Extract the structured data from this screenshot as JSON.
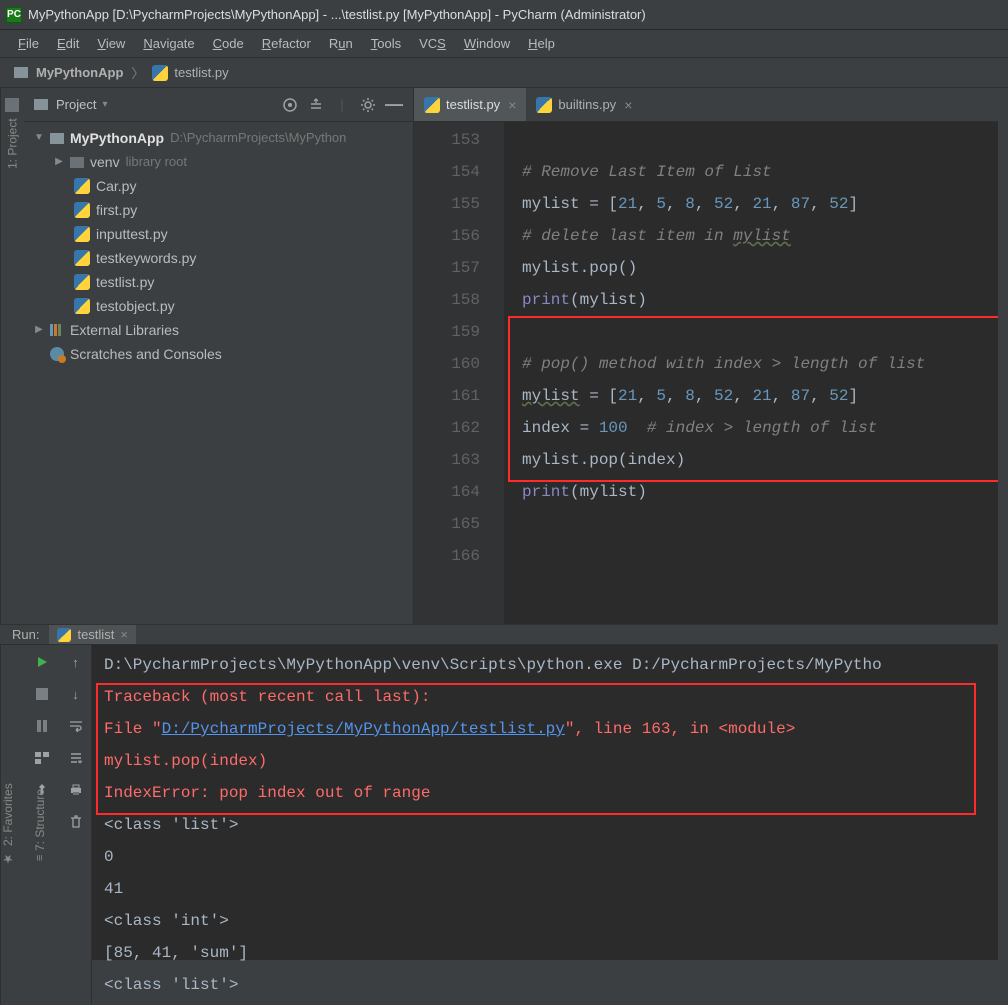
{
  "titlebar": {
    "app_icon": "PC",
    "title": "MyPythonApp [D:\\PycharmProjects\\MyPythonApp] - ...\\testlist.py [MyPythonApp] - PyCharm (Administrator)"
  },
  "menubar": [
    "File",
    "Edit",
    "View",
    "Navigate",
    "Code",
    "Refactor",
    "Run",
    "Tools",
    "VCS",
    "Window",
    "Help"
  ],
  "breadcrumb": {
    "project": "MyPythonApp",
    "file": "testlist.py"
  },
  "leftbar": {
    "project_label": "1: Project"
  },
  "project_panel": {
    "title": "Project",
    "tree": {
      "root": {
        "name": "MyPythonApp",
        "path": "D:\\PycharmProjects\\MyPython"
      },
      "venv": {
        "name": "venv",
        "hint": "library root"
      },
      "files": [
        "Car.py",
        "first.py",
        "inputtest.py",
        "testkeywords.py",
        "testlist.py",
        "testobject.py"
      ],
      "external_libs": "External Libraries",
      "scratches": "Scratches and Consoles"
    }
  },
  "editor": {
    "tabs": [
      {
        "label": "testlist.py",
        "active": true
      },
      {
        "label": "builtins.py",
        "active": false
      }
    ],
    "lines": [
      {
        "no": 153,
        "tokens": []
      },
      {
        "no": 154,
        "tokens": [
          [
            "comment",
            "# Remove Last Item of List"
          ]
        ]
      },
      {
        "no": 155,
        "tokens": [
          [
            "id",
            "mylist"
          ],
          [
            "op",
            " = ["
          ],
          [
            "num",
            "21"
          ],
          [
            "op",
            ", "
          ],
          [
            "num",
            "5"
          ],
          [
            "op",
            ", "
          ],
          [
            "num",
            "8"
          ],
          [
            "op",
            ", "
          ],
          [
            "num",
            "52"
          ],
          [
            "op",
            ", "
          ],
          [
            "num",
            "21"
          ],
          [
            "op",
            ", "
          ],
          [
            "num",
            "87"
          ],
          [
            "op",
            ", "
          ],
          [
            "num",
            "52"
          ],
          [
            "op",
            "]"
          ]
        ]
      },
      {
        "no": 156,
        "tokens": [
          [
            "comment",
            "# delete last item in "
          ],
          [
            "comment-ul",
            "mylist"
          ]
        ]
      },
      {
        "no": 157,
        "tokens": [
          [
            "id",
            "mylist"
          ],
          [
            "op",
            ".pop()"
          ]
        ]
      },
      {
        "no": 158,
        "tokens": [
          [
            "builtin",
            "print"
          ],
          [
            "op",
            "(mylist)"
          ]
        ]
      },
      {
        "no": 159,
        "tokens": []
      },
      {
        "no": 160,
        "tokens": [
          [
            "comment",
            "# pop() method with index > length of list"
          ]
        ]
      },
      {
        "no": 161,
        "tokens": [
          [
            "id-ul",
            "mylist"
          ],
          [
            "op",
            " = ["
          ],
          [
            "num",
            "21"
          ],
          [
            "op",
            ", "
          ],
          [
            "num",
            "5"
          ],
          [
            "op",
            ", "
          ],
          [
            "num",
            "8"
          ],
          [
            "op",
            ", "
          ],
          [
            "num",
            "52"
          ],
          [
            "op",
            ", "
          ],
          [
            "num",
            "21"
          ],
          [
            "op",
            ", "
          ],
          [
            "num",
            "87"
          ],
          [
            "op",
            ", "
          ],
          [
            "num",
            "52"
          ],
          [
            "op",
            "]"
          ]
        ]
      },
      {
        "no": 162,
        "tokens": [
          [
            "id",
            "index"
          ],
          [
            "op",
            " = "
          ],
          [
            "num",
            "100"
          ],
          [
            "op",
            "  "
          ],
          [
            "comment",
            "# index > length of list"
          ]
        ]
      },
      {
        "no": 163,
        "tokens": [
          [
            "id",
            "mylist"
          ],
          [
            "op",
            ".pop(index)"
          ]
        ]
      },
      {
        "no": 164,
        "tokens": [
          [
            "builtin",
            "print"
          ],
          [
            "op",
            "(mylist)"
          ]
        ]
      },
      {
        "no": 165,
        "tokens": []
      },
      {
        "no": 166,
        "tokens": []
      }
    ]
  },
  "run_panel": {
    "header_label": "Run:",
    "tab_label": "testlist",
    "output": {
      "cmd": "D:\\PycharmProjects\\MyPythonApp\\venv\\Scripts\\python.exe D:/PycharmProjects/MyPytho",
      "traceback_head": "Traceback (most recent call last):",
      "file_prefix": "  File \"",
      "file_link": "D:/PycharmProjects/MyPythonApp/testlist.py",
      "file_suffix": "\", line 163, in <module>",
      "frame_code": "    mylist.pop(index)",
      "error": "IndexError: pop index out of range",
      "rest": [
        "<class 'list'>",
        "0",
        "41",
        "<class 'int'>",
        "[85, 41, 'sum']",
        "<class 'list'>"
      ]
    },
    "left_labels": {
      "structure": "7: Structure",
      "favorites": "2: Favorites"
    }
  }
}
